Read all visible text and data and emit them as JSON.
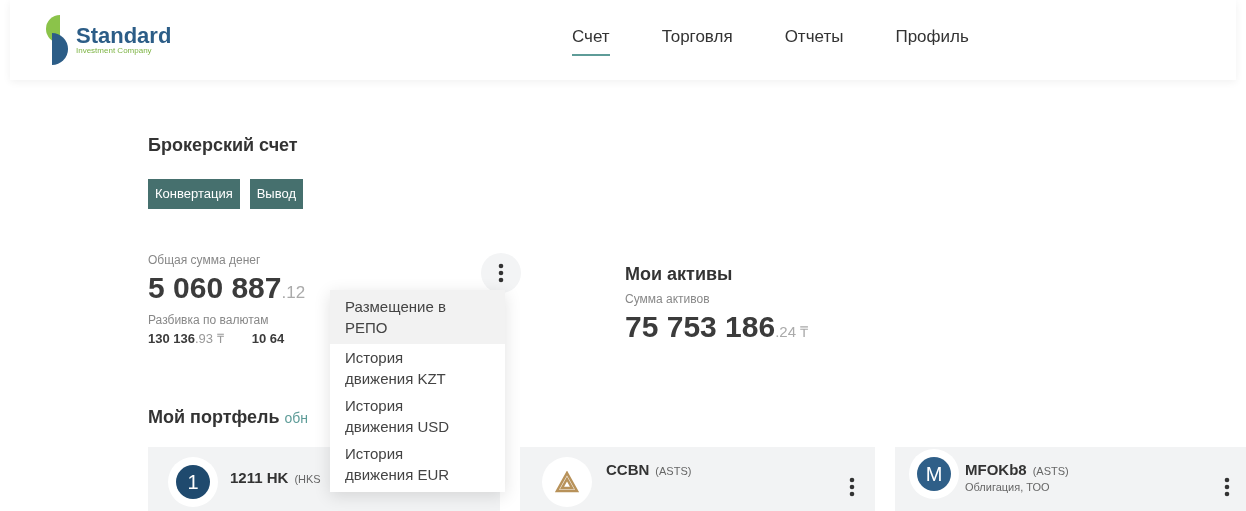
{
  "header": {
    "logo": {
      "name": "Standard",
      "tagline": "Investment Company"
    },
    "nav": [
      {
        "label": "Счет",
        "selected": true
      },
      {
        "label": "Торговля",
        "selected": false
      },
      {
        "label": "Отчеты",
        "selected": false
      },
      {
        "label": "Профиль",
        "selected": false
      }
    ]
  },
  "account": {
    "title": "Брокерский счет",
    "buttons": [
      "Конвертация",
      "Вывод"
    ]
  },
  "money": {
    "label": "Общая сумма денег",
    "whole": "5 060 887",
    "fraction": ".12",
    "breakdown_label": "Разбивка по валютам",
    "currencies": [
      {
        "whole": "130 136",
        "fraction": ".93",
        "symbol": "₸"
      },
      {
        "whole": "10 64"
      }
    ]
  },
  "menu": [
    {
      "label": "Размещение в РЕПО",
      "selected": true
    },
    {
      "label": "История движения KZT",
      "selected": false
    },
    {
      "label": "История движения USD",
      "selected": false
    },
    {
      "label": "История движения EUR",
      "selected": false
    }
  ],
  "assets": {
    "title": "Мои активы",
    "label": "Сумма активов",
    "whole": "75 753 186",
    "fraction": ".24",
    "symbol": "₸"
  },
  "portfolio": {
    "title": "Мой портфель",
    "note": "обн",
    "cards": [
      {
        "kind": "number",
        "avatar": "1",
        "ticker": "1211 HK",
        "exchange": "(HKS"
      },
      {
        "kind": "logo",
        "ticker": "CCBN",
        "exchange": "(ASTS)"
      },
      {
        "kind": "letter",
        "avatar": "M",
        "ticker": "MFOKb8",
        "exchange": "(ASTS)",
        "subtitle": "Облигация, ТОО"
      }
    ]
  }
}
